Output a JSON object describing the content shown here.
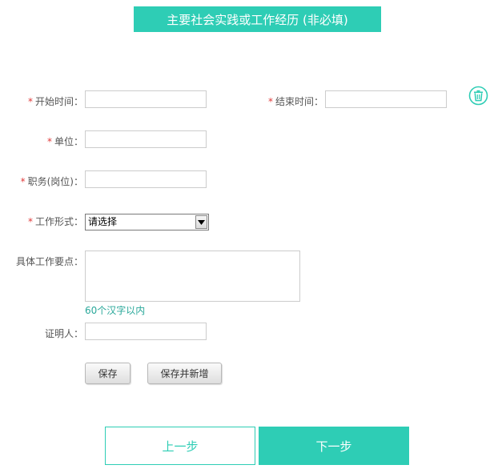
{
  "section": {
    "title": "主要社会实践或工作经历 (非必填)"
  },
  "form": {
    "required_mark": "*",
    "start_time": {
      "label": "开始时间：",
      "value": ""
    },
    "end_time": {
      "label": "结束时间：",
      "value": ""
    },
    "unit": {
      "label": "单位：",
      "value": ""
    },
    "position": {
      "label": "职务(岗位)：",
      "value": ""
    },
    "work_type": {
      "label": "工作形式：",
      "selected": "请选择"
    },
    "work_points": {
      "label": "具体工作要点：",
      "value": "",
      "hint": "60个汉字以内"
    },
    "witness": {
      "label": "证明人：",
      "value": ""
    }
  },
  "actions": {
    "save_label": "保存",
    "save_add_label": "保存并新增"
  },
  "icons": {
    "delete": "trash-icon"
  },
  "nav": {
    "prev_label": "上一步",
    "next_label": "下一步"
  },
  "colors": {
    "accent": "#2ecdb5",
    "required": "#e03a3a",
    "hint": "#2aa89a"
  }
}
